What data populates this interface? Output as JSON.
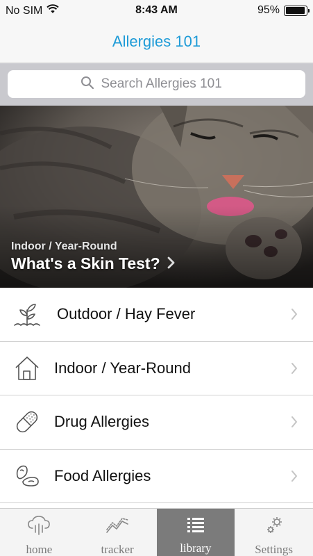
{
  "status_bar": {
    "carrier": "No SIM",
    "time": "8:43 AM",
    "battery": "95%",
    "battery_level": 0.95
  },
  "nav": {
    "title": "Allergies 101"
  },
  "search": {
    "placeholder": "Search Allergies 101"
  },
  "hero": {
    "category": "Indoor / Year-Round",
    "title": "What's a Skin Test?"
  },
  "list": {
    "items": [
      {
        "label": "Outdoor / Hay Fever",
        "icon": "plant-icon"
      },
      {
        "label": "Indoor / Year-Round",
        "icon": "house-icon"
      },
      {
        "label": "Drug Allergies",
        "icon": "pill-icon"
      },
      {
        "label": "Food Allergies",
        "icon": "beans-icon"
      }
    ]
  },
  "tab_bar": {
    "tabs": [
      {
        "label": "home",
        "icon": "cloud-rain-icon",
        "active": false
      },
      {
        "label": "tracker",
        "icon": "line-chart-icon",
        "active": false
      },
      {
        "label": "library",
        "icon": "list-icon",
        "active": true
      },
      {
        "label": "Settings",
        "icon": "gears-icon",
        "active": false
      }
    ]
  },
  "colors": {
    "accent": "#1e9bd7",
    "active_tab": "#7b7b7b",
    "search_band": "#c9c9ce"
  }
}
